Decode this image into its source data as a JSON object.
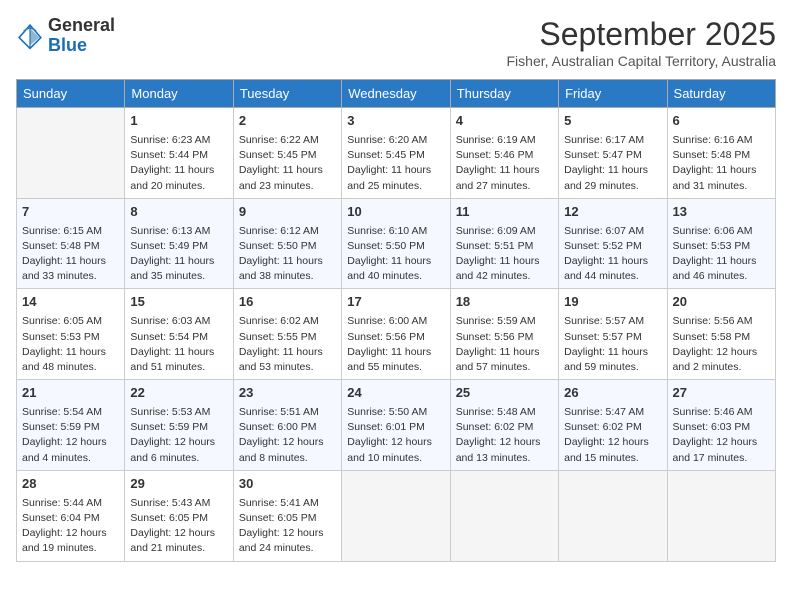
{
  "header": {
    "logo_line1": "General",
    "logo_line2": "Blue",
    "month": "September 2025",
    "location": "Fisher, Australian Capital Territory, Australia"
  },
  "days_of_week": [
    "Sunday",
    "Monday",
    "Tuesday",
    "Wednesday",
    "Thursday",
    "Friday",
    "Saturday"
  ],
  "weeks": [
    [
      {
        "day": "",
        "info": ""
      },
      {
        "day": "1",
        "info": "Sunrise: 6:23 AM\nSunset: 5:44 PM\nDaylight: 11 hours\nand 20 minutes."
      },
      {
        "day": "2",
        "info": "Sunrise: 6:22 AM\nSunset: 5:45 PM\nDaylight: 11 hours\nand 23 minutes."
      },
      {
        "day": "3",
        "info": "Sunrise: 6:20 AM\nSunset: 5:45 PM\nDaylight: 11 hours\nand 25 minutes."
      },
      {
        "day": "4",
        "info": "Sunrise: 6:19 AM\nSunset: 5:46 PM\nDaylight: 11 hours\nand 27 minutes."
      },
      {
        "day": "5",
        "info": "Sunrise: 6:17 AM\nSunset: 5:47 PM\nDaylight: 11 hours\nand 29 minutes."
      },
      {
        "day": "6",
        "info": "Sunrise: 6:16 AM\nSunset: 5:48 PM\nDaylight: 11 hours\nand 31 minutes."
      }
    ],
    [
      {
        "day": "7",
        "info": "Sunrise: 6:15 AM\nSunset: 5:48 PM\nDaylight: 11 hours\nand 33 minutes."
      },
      {
        "day": "8",
        "info": "Sunrise: 6:13 AM\nSunset: 5:49 PM\nDaylight: 11 hours\nand 35 minutes."
      },
      {
        "day": "9",
        "info": "Sunrise: 6:12 AM\nSunset: 5:50 PM\nDaylight: 11 hours\nand 38 minutes."
      },
      {
        "day": "10",
        "info": "Sunrise: 6:10 AM\nSunset: 5:50 PM\nDaylight: 11 hours\nand 40 minutes."
      },
      {
        "day": "11",
        "info": "Sunrise: 6:09 AM\nSunset: 5:51 PM\nDaylight: 11 hours\nand 42 minutes."
      },
      {
        "day": "12",
        "info": "Sunrise: 6:07 AM\nSunset: 5:52 PM\nDaylight: 11 hours\nand 44 minutes."
      },
      {
        "day": "13",
        "info": "Sunrise: 6:06 AM\nSunset: 5:53 PM\nDaylight: 11 hours\nand 46 minutes."
      }
    ],
    [
      {
        "day": "14",
        "info": "Sunrise: 6:05 AM\nSunset: 5:53 PM\nDaylight: 11 hours\nand 48 minutes."
      },
      {
        "day": "15",
        "info": "Sunrise: 6:03 AM\nSunset: 5:54 PM\nDaylight: 11 hours\nand 51 minutes."
      },
      {
        "day": "16",
        "info": "Sunrise: 6:02 AM\nSunset: 5:55 PM\nDaylight: 11 hours\nand 53 minutes."
      },
      {
        "day": "17",
        "info": "Sunrise: 6:00 AM\nSunset: 5:56 PM\nDaylight: 11 hours\nand 55 minutes."
      },
      {
        "day": "18",
        "info": "Sunrise: 5:59 AM\nSunset: 5:56 PM\nDaylight: 11 hours\nand 57 minutes."
      },
      {
        "day": "19",
        "info": "Sunrise: 5:57 AM\nSunset: 5:57 PM\nDaylight: 11 hours\nand 59 minutes."
      },
      {
        "day": "20",
        "info": "Sunrise: 5:56 AM\nSunset: 5:58 PM\nDaylight: 12 hours\nand 2 minutes."
      }
    ],
    [
      {
        "day": "21",
        "info": "Sunrise: 5:54 AM\nSunset: 5:59 PM\nDaylight: 12 hours\nand 4 minutes."
      },
      {
        "day": "22",
        "info": "Sunrise: 5:53 AM\nSunset: 5:59 PM\nDaylight: 12 hours\nand 6 minutes."
      },
      {
        "day": "23",
        "info": "Sunrise: 5:51 AM\nSunset: 6:00 PM\nDaylight: 12 hours\nand 8 minutes."
      },
      {
        "day": "24",
        "info": "Sunrise: 5:50 AM\nSunset: 6:01 PM\nDaylight: 12 hours\nand 10 minutes."
      },
      {
        "day": "25",
        "info": "Sunrise: 5:48 AM\nSunset: 6:02 PM\nDaylight: 12 hours\nand 13 minutes."
      },
      {
        "day": "26",
        "info": "Sunrise: 5:47 AM\nSunset: 6:02 PM\nDaylight: 12 hours\nand 15 minutes."
      },
      {
        "day": "27",
        "info": "Sunrise: 5:46 AM\nSunset: 6:03 PM\nDaylight: 12 hours\nand 17 minutes."
      }
    ],
    [
      {
        "day": "28",
        "info": "Sunrise: 5:44 AM\nSunset: 6:04 PM\nDaylight: 12 hours\nand 19 minutes."
      },
      {
        "day": "29",
        "info": "Sunrise: 5:43 AM\nSunset: 6:05 PM\nDaylight: 12 hours\nand 21 minutes."
      },
      {
        "day": "30",
        "info": "Sunrise: 5:41 AM\nSunset: 6:05 PM\nDaylight: 12 hours\nand 24 minutes."
      },
      {
        "day": "",
        "info": ""
      },
      {
        "day": "",
        "info": ""
      },
      {
        "day": "",
        "info": ""
      },
      {
        "day": "",
        "info": ""
      }
    ]
  ]
}
